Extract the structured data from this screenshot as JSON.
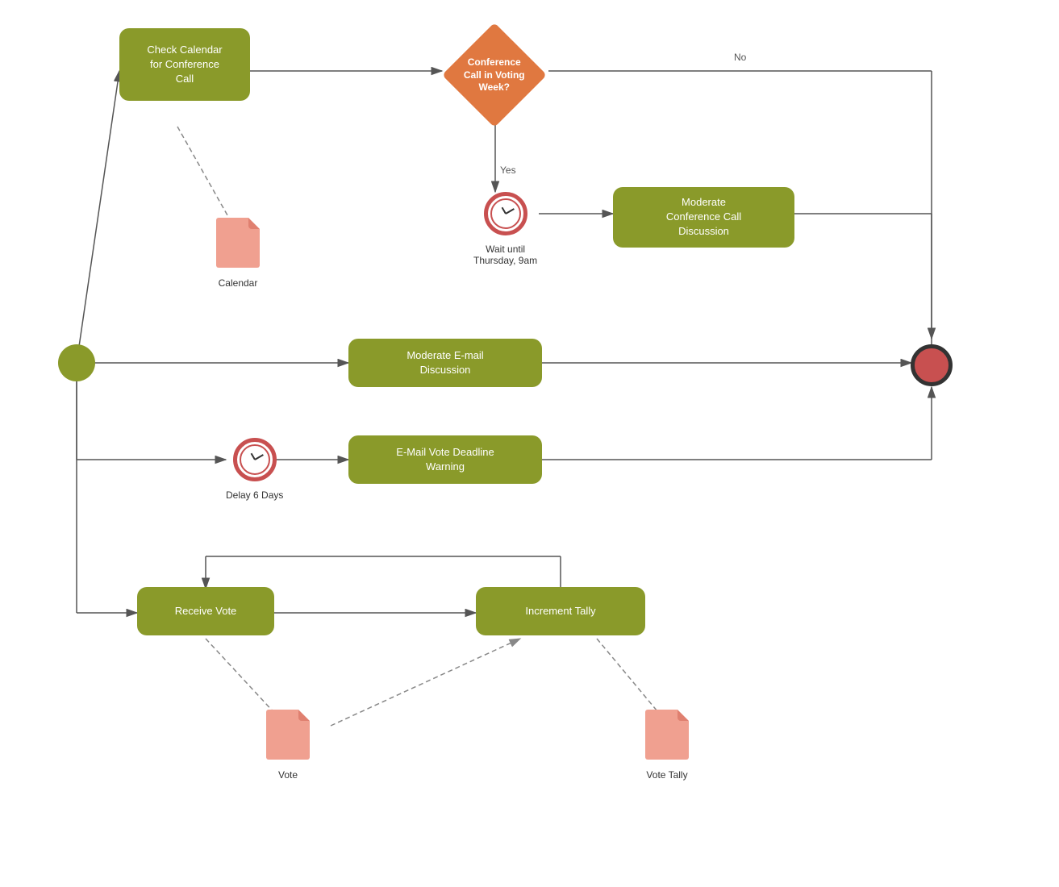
{
  "nodes": {
    "start": {
      "label": "Start"
    },
    "check_calendar": {
      "label": "Check Calendar\nfor Conference\nCall"
    },
    "conference_call_decision": {
      "label": "Conference\nCall in Voting\nWeek?"
    },
    "wait_thursday": {
      "label": "Wait until\nThursday, 9am"
    },
    "moderate_conference": {
      "label": "Moderate\nConference Call\nDiscussion"
    },
    "moderate_email": {
      "label": "Moderate E-mail\nDiscussion"
    },
    "end": {
      "label": "End"
    },
    "delay6days": {
      "label": "Delay 6 Days"
    },
    "email_warning": {
      "label": "E-Mail Vote Deadline\nWarning"
    },
    "receive_vote": {
      "label": "Receive Vote"
    },
    "increment_tally": {
      "label": "Increment Tally"
    },
    "calendar_doc": {
      "label": "Calendar"
    },
    "vote_doc": {
      "label": "Vote"
    },
    "vote_tally_doc": {
      "label": "Vote Tally"
    }
  },
  "labels": {
    "no": "No",
    "yes": "Yes"
  },
  "colors": {
    "task": "#8a9a2a",
    "decision": "#e07840",
    "start": "#8a9a2a",
    "end": "#c85050",
    "clock_border": "#c85050",
    "doc": "#f0a090"
  }
}
